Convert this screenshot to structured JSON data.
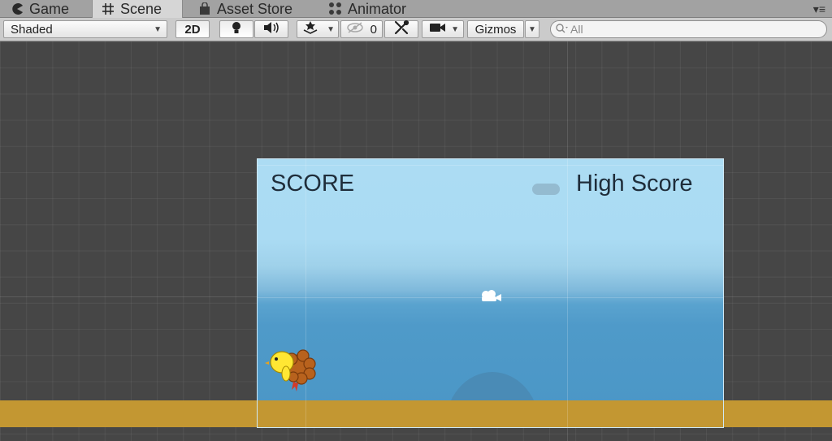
{
  "tabs": [
    {
      "label": "Game",
      "icon": "pacman-icon",
      "active": false
    },
    {
      "label": "Scene",
      "icon": "grid-hash-icon",
      "active": true
    },
    {
      "label": "Asset Store",
      "icon": "shopping-bag-icon",
      "active": false
    },
    {
      "label": "Animator",
      "icon": "animator-nodes-icon",
      "active": false
    }
  ],
  "toolbar": {
    "draw_mode": "Shaded",
    "mode_2d": "2D",
    "hidden_count": "0",
    "gizmos": "Gizmos",
    "search_placeholder": "All"
  },
  "game": {
    "score_label": "SCORE",
    "high_score_label": "High Score"
  },
  "colors": {
    "scene_bg": "#464646",
    "sky_top": "#acdcf3",
    "sky_bottom": "#4a96c6",
    "ground": "#c39732"
  }
}
